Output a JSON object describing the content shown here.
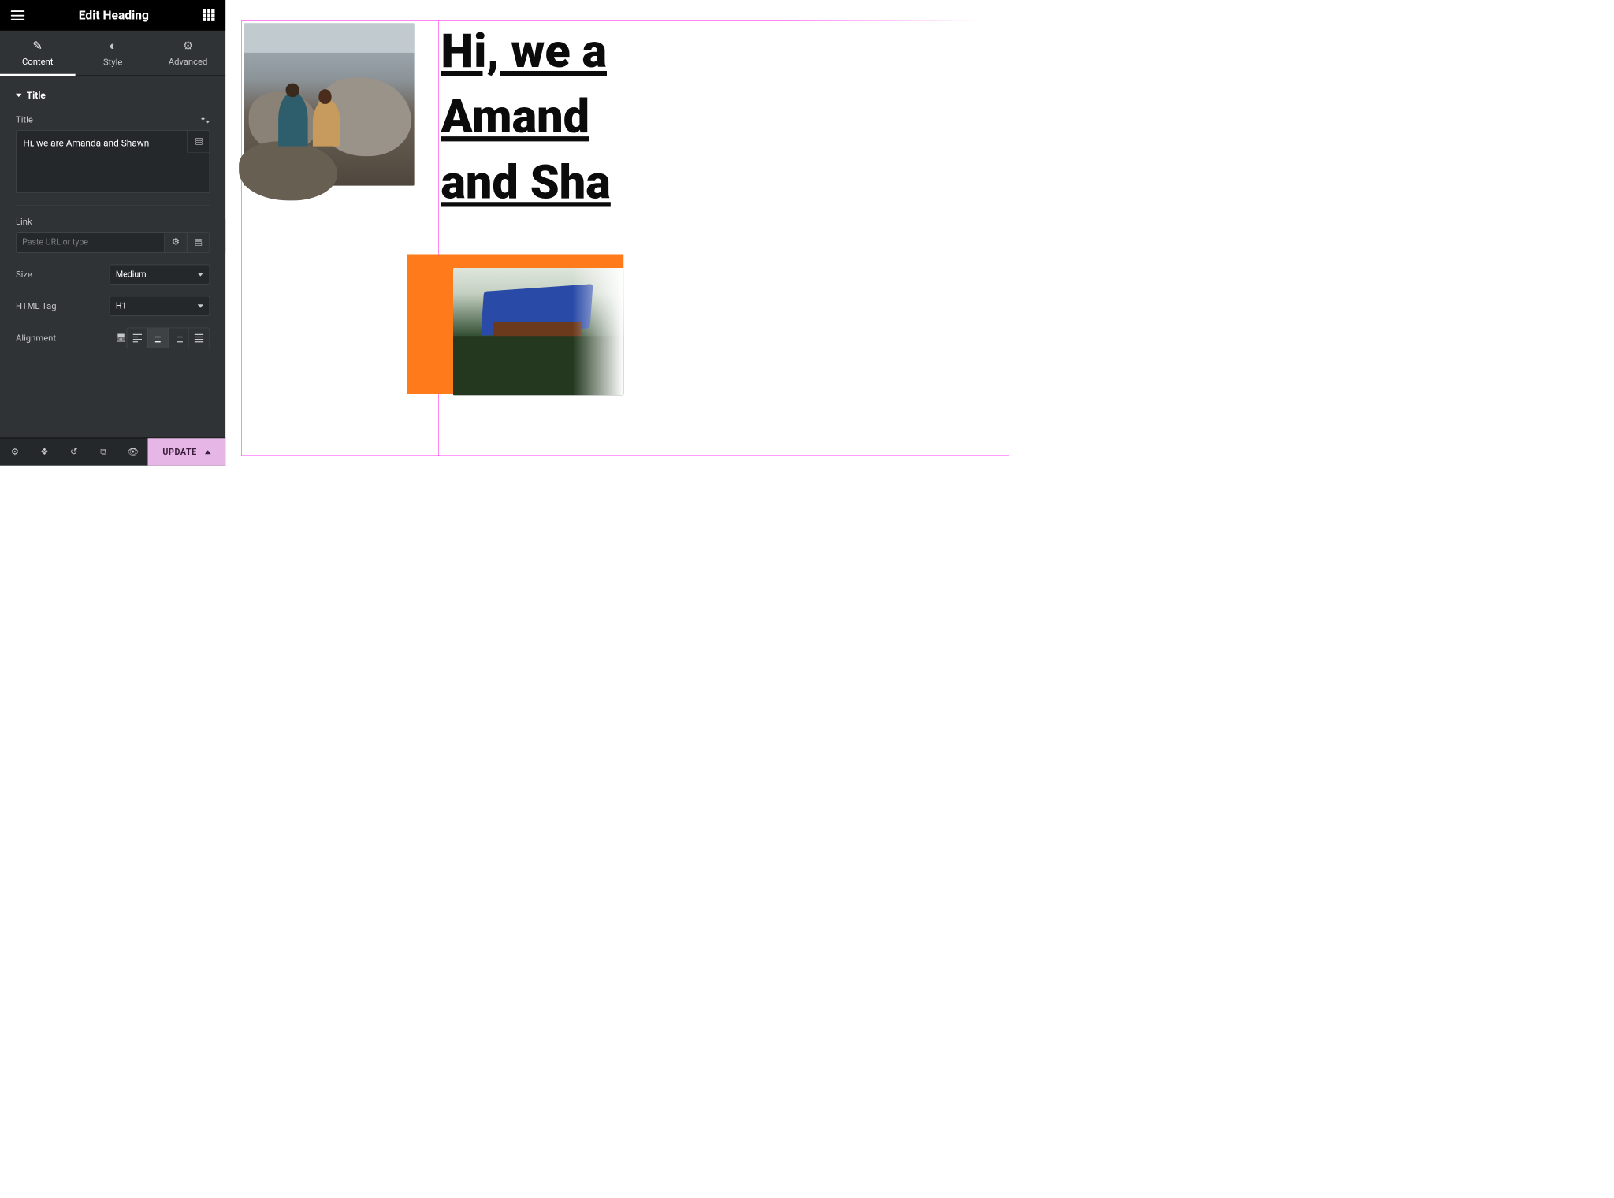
{
  "header": {
    "title": "Edit Heading"
  },
  "tabs": {
    "content": "Content",
    "style": "Style",
    "advanced": "Advanced",
    "active": "content"
  },
  "section": {
    "title": "Title"
  },
  "fields": {
    "title_label": "Title",
    "title_value": "Hi, we are Amanda and Shawn",
    "link_label": "Link",
    "link_placeholder": "Paste URL or type",
    "size_label": "Size",
    "size_value": "Medium",
    "htmltag_label": "HTML Tag",
    "htmltag_value": "H1",
    "alignment_label": "Alignment",
    "alignment_value": "center"
  },
  "footer": {
    "update": "UPDATE"
  },
  "canvas": {
    "heading_text": "Hi, we are Amanda and Shawn",
    "heading_line1": "Hi, we a",
    "heading_line2": "Amand",
    "heading_line3": "and Sha",
    "accent_color": "#ff7a1a"
  }
}
